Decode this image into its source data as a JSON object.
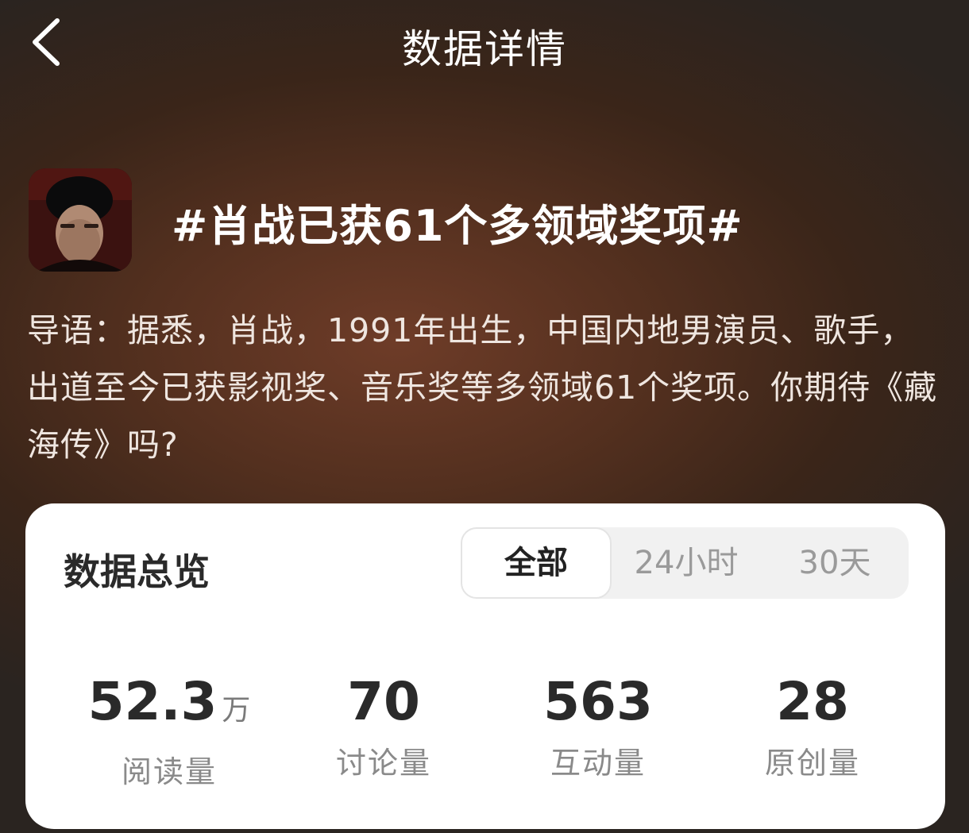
{
  "header": {
    "title": "数据详情",
    "back_icon": "chevron-left-icon"
  },
  "topic": {
    "title": "#肖战已获61个多领域奖项#",
    "intro": "导语：据悉，肖战，1991年出生，中国内地男演员、歌手，出道至今已获影视奖、音乐奖等多领域61个奖项。你期待《藏海传》吗?"
  },
  "overview": {
    "title": "数据总览",
    "tabs": [
      {
        "label": "全部",
        "active": true
      },
      {
        "label": "24小时",
        "active": false
      },
      {
        "label": "30天",
        "active": false
      }
    ],
    "stats": [
      {
        "value": "52.3",
        "unit": "万",
        "label": "阅读量"
      },
      {
        "value": "70",
        "unit": "",
        "label": "讨论量"
      },
      {
        "value": "563",
        "unit": "",
        "label": "互动量"
      },
      {
        "value": "28",
        "unit": "",
        "label": "原创量"
      }
    ]
  },
  "colors": {
    "background_top": "#2a2420",
    "background_glow": "#6e3c28",
    "card": "#ffffff",
    "text_primary": "#2a2a2a",
    "text_secondary": "#8a8a8a"
  }
}
